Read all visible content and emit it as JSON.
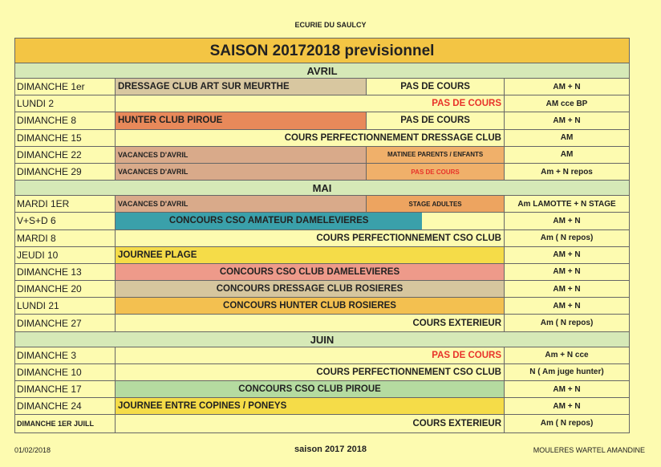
{
  "header": {
    "organization": "ECURIE DU SAULCY"
  },
  "season_title": "SAISON 20172018 previsionnel",
  "months": [
    {
      "name": "AVRIL",
      "rows": [
        {
          "day": "DIMANCHE 1er",
          "event": "DRESSAGE CLUB ART SUR MEURTHE",
          "event_color": "#d8c7a0",
          "event_width": 0.645,
          "note": "PAS DE COURS",
          "note_color": "",
          "staff": "AM + N"
        },
        {
          "day": "LUNDI 2",
          "event": "",
          "event_color": "",
          "event_width": 0,
          "note": "",
          "event_right": "PAS DE COURS",
          "event_right_red": true,
          "staff": "AM  cce BP"
        },
        {
          "day": "DIMANCHE 8",
          "event": "HUNTER CLUB PIROUE",
          "event_color": "#e8895a",
          "event_width": 0.645,
          "note": "PAS DE COURS",
          "note_color": "",
          "staff": "AM + N"
        },
        {
          "day": "DIMANCHE 15",
          "event": "",
          "event_color": "",
          "event_width": 0,
          "note": "",
          "event_right": "COURS PERFECTIONNEMENT DRESSAGE CLUB",
          "staff": "AM"
        },
        {
          "day": "DIMANCHE 22",
          "event": "VACANCES D'AVRIL",
          "event_color": "#d9aa8a",
          "event_width": 0.645,
          "event_small": true,
          "note": "MATINEE PARENTS / ENFANTS",
          "note_color": "#f0b06a",
          "note_small": true,
          "staff": "AM"
        },
        {
          "day": "DIMANCHE 29",
          "event": "VACANCES D'AVRIL",
          "event_color": "#d9aa8a",
          "event_width": 0.645,
          "event_small": true,
          "note": "PAS DE COURS",
          "note_color": "#f0b06a",
          "note_small": true,
          "note_red": true,
          "staff": "Am + N repos"
        }
      ]
    },
    {
      "name": "MAI",
      "rows": [
        {
          "day": "MARDI 1ER",
          "event": "VACANCES D'AVRIL",
          "event_color": "#d9aa8a",
          "event_width": 0.645,
          "event_small": true,
          "note": "STAGE ADULTES",
          "note_color": "#eda460",
          "note_small": true,
          "staff": "Am LAMOTTE + N STAGE"
        },
        {
          "day": "V+S+D 6",
          "event": "CONCOURS CSO AMATEUR DAMELEVIERES",
          "event_color": "#3aa0aa",
          "event_width": 0.79,
          "event_center": true,
          "note": "",
          "staff": "AM + N"
        },
        {
          "day": "MARDI 8",
          "event": "",
          "event_color": "",
          "event_width": 0,
          "note": "",
          "event_right": "COURS PERFECTIONNEMENT CSO CLUB",
          "staff": "Am ( N repos)"
        },
        {
          "day": "JEUDI 10",
          "event": "JOURNEE PLAGE",
          "event_color": "#f5dc48",
          "event_width": 1.0,
          "note": "",
          "staff": "AM + N"
        },
        {
          "day": "DIMANCHE 13",
          "event": "CONCOURS CSO CLUB DAMELEVIERES",
          "event_color": "#ee9a8a",
          "event_width": 1.0,
          "event_center": true,
          "note": "",
          "staff": "AM + N"
        },
        {
          "day": "DIMANCHE 20",
          "event": "CONCOURS DRESSAGE CLUB ROSIERES",
          "event_color": "#d6c69e",
          "event_width": 1.0,
          "event_center": true,
          "note": "",
          "staff": "AM + N"
        },
        {
          "day": "LUNDI 21",
          "event": "CONCOURS HUNTER CLUB ROSIERES",
          "event_color": "#f3c050",
          "event_width": 1.0,
          "event_center": true,
          "note": "",
          "staff": "AM + N"
        },
        {
          "day": "DIMANCHE 27",
          "event": "",
          "event_color": "",
          "event_width": 0,
          "note": "",
          "event_right": "COURS EXTERIEUR",
          "staff": "Am ( N repos)"
        }
      ]
    },
    {
      "name": "JUIN",
      "rows": [
        {
          "day": "DIMANCHE 3",
          "event": "",
          "event_color": "",
          "event_width": 0,
          "note": "",
          "event_right": "PAS DE COURS",
          "event_right_red": true,
          "staff": "Am + N cce"
        },
        {
          "day": "DIMANCHE 10",
          "event": "",
          "event_color": "",
          "event_width": 0,
          "note": "",
          "event_right": "COURS PERFECTIONNEMENT CSO CLUB",
          "staff": "N ( Am juge hunter)"
        },
        {
          "day": "DIMANCHE 17",
          "event": "CONCOURS CSO CLUB PIROUE",
          "event_color": "#b5dba0",
          "event_width": 1.0,
          "event_center": true,
          "note": "",
          "staff": "AM + N"
        },
        {
          "day": "DIMANCHE 24",
          "event": "JOURNEE ENTRE COPINES / PONEYS",
          "event_color": "#f5dc48",
          "event_width": 1.0,
          "note": "",
          "staff": "AM + N"
        },
        {
          "day": "DIMANCHE 1ER JUILL",
          "day_small": true,
          "event": "",
          "event_color": "",
          "event_width": 0,
          "note": "",
          "event_right": "COURS EXTERIEUR",
          "staff": "Am ( N repos)"
        }
      ]
    }
  ],
  "footer": {
    "date": "01/02/2018",
    "center": "saison 2017 2018",
    "author": "MOULERES WARTEL AMANDINE"
  }
}
